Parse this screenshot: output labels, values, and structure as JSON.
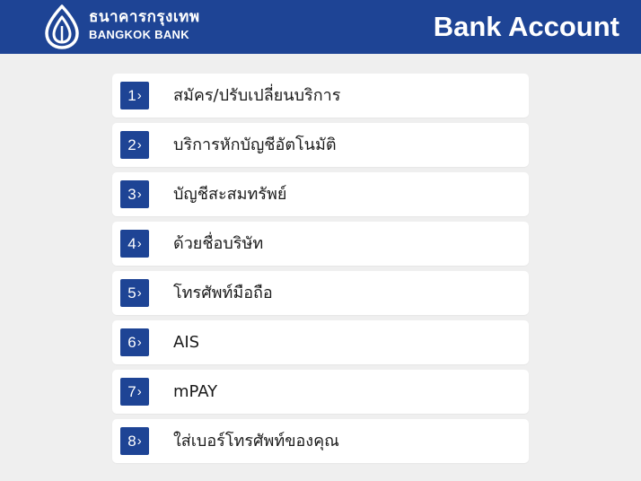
{
  "brand": {
    "thai_name": "ธนาคารกรุงเทพ",
    "english_name": "BANGKOK BANK",
    "logo_icon": "bangkok-bank-lotus-logo",
    "color": "#1e4495"
  },
  "header": {
    "title": "Bank Account",
    "background": "#1e4495"
  },
  "menu": {
    "chevron": "›",
    "items": [
      {
        "number": "1",
        "label": "สมัคร/ปรับเปลี่ยนบริการ"
      },
      {
        "number": "2",
        "label": "บริการหักบัญชีอัตโนมัติ"
      },
      {
        "number": "3",
        "label": "บัญชีสะสมทรัพย์"
      },
      {
        "number": "4",
        "label": "ด้วยชื่อบริษัท"
      },
      {
        "number": "5",
        "label": "โทรศัพท์มือถือ"
      },
      {
        "number": "6",
        "label": "AIS"
      },
      {
        "number": "7",
        "label": "mPAY"
      },
      {
        "number": "8",
        "label": "ใส่เบอร์โทรศัพท์ของคุณ"
      }
    ]
  }
}
